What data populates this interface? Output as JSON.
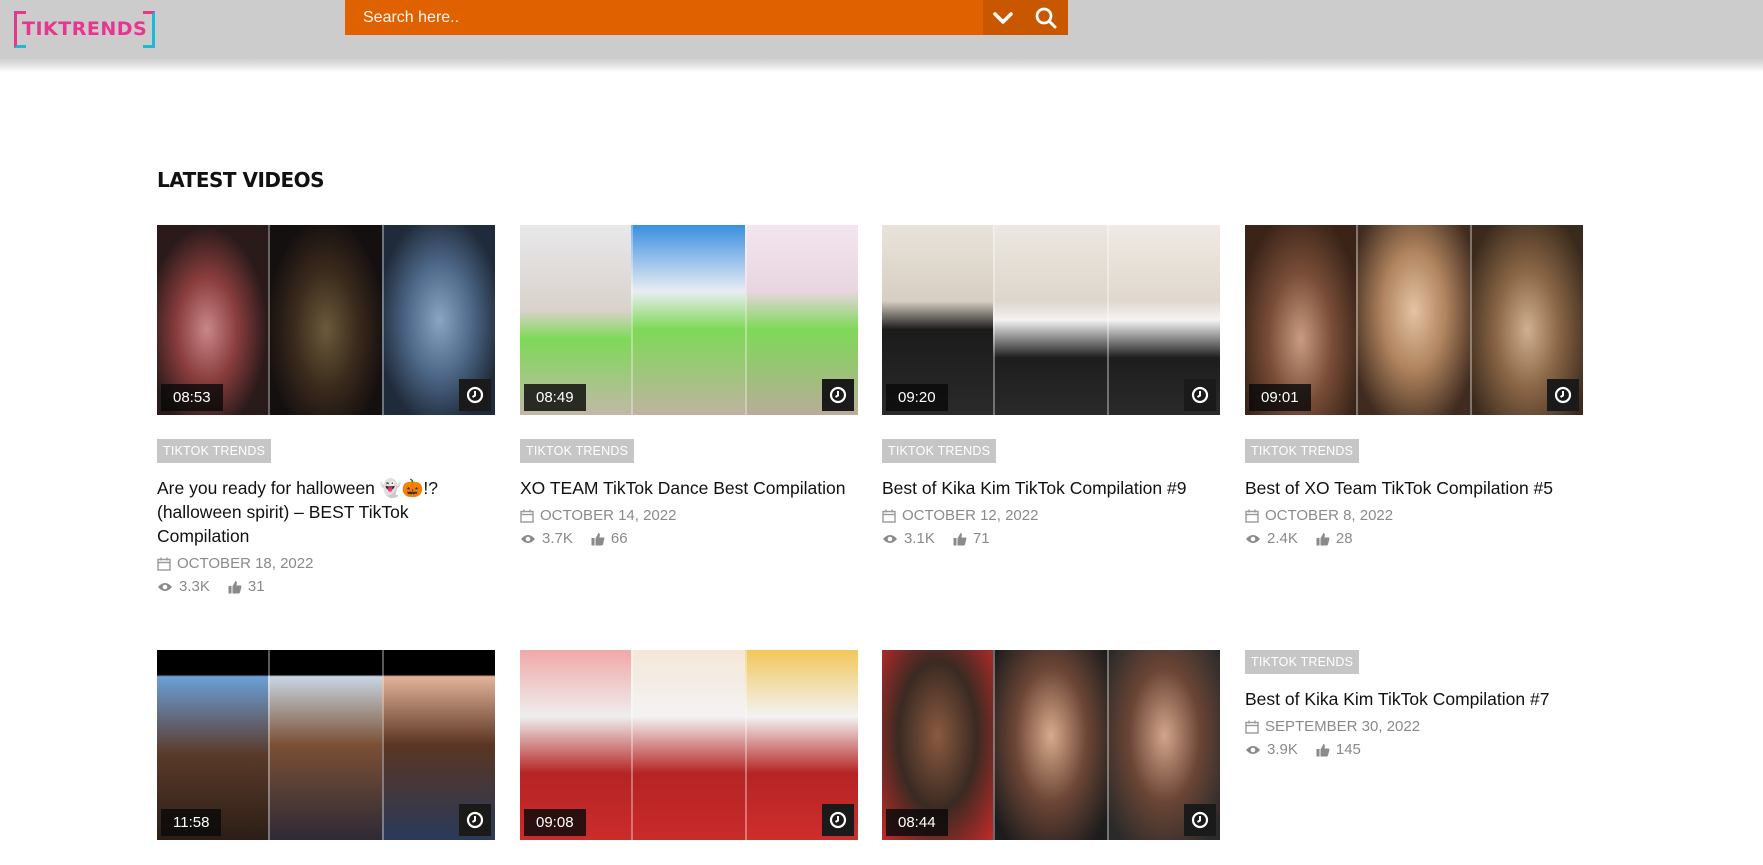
{
  "header": {
    "logo_text": "TIKTRENDS",
    "search_placeholder": "Search here..",
    "accent_color": "#e06100"
  },
  "section": {
    "title": "LATEST VIDEOS"
  },
  "videos": [
    {
      "duration": "08:53",
      "category": "TIKTOK TRENDS",
      "title": "Are you ready for halloween 👻🎃!? (halloween spirit) – BEST TikTok Compilation",
      "date": "OCTOBER 18, 2022",
      "views": "3.3K",
      "likes": "31"
    },
    {
      "duration": "08:49",
      "category": "TIKTOK TRENDS",
      "title": "XO TEAM TikTok Dance Best Compilation",
      "date": "OCTOBER 14, 2022",
      "views": "3.7K",
      "likes": "66"
    },
    {
      "duration": "09:20",
      "category": "TIKTOK TRENDS",
      "title": "Best of Kika Kim TikTok Compilation #9",
      "date": "OCTOBER 12, 2022",
      "views": "3.1K",
      "likes": "71"
    },
    {
      "duration": "09:01",
      "category": "TIKTOK TRENDS",
      "title": "Best of XO Team TikTok Compilation #5",
      "date": "OCTOBER 8, 2022",
      "views": "2.4K",
      "likes": "28"
    },
    {
      "duration": "11:58"
    },
    {
      "duration": "09:08"
    },
    {
      "duration": "08:44"
    },
    {
      "category": "TIKTOK TRENDS",
      "title": "Best of Kika Kim TikTok Compilation #7",
      "date": "SEPTEMBER 30, 2022",
      "views": "3.9K",
      "likes": "145"
    }
  ]
}
